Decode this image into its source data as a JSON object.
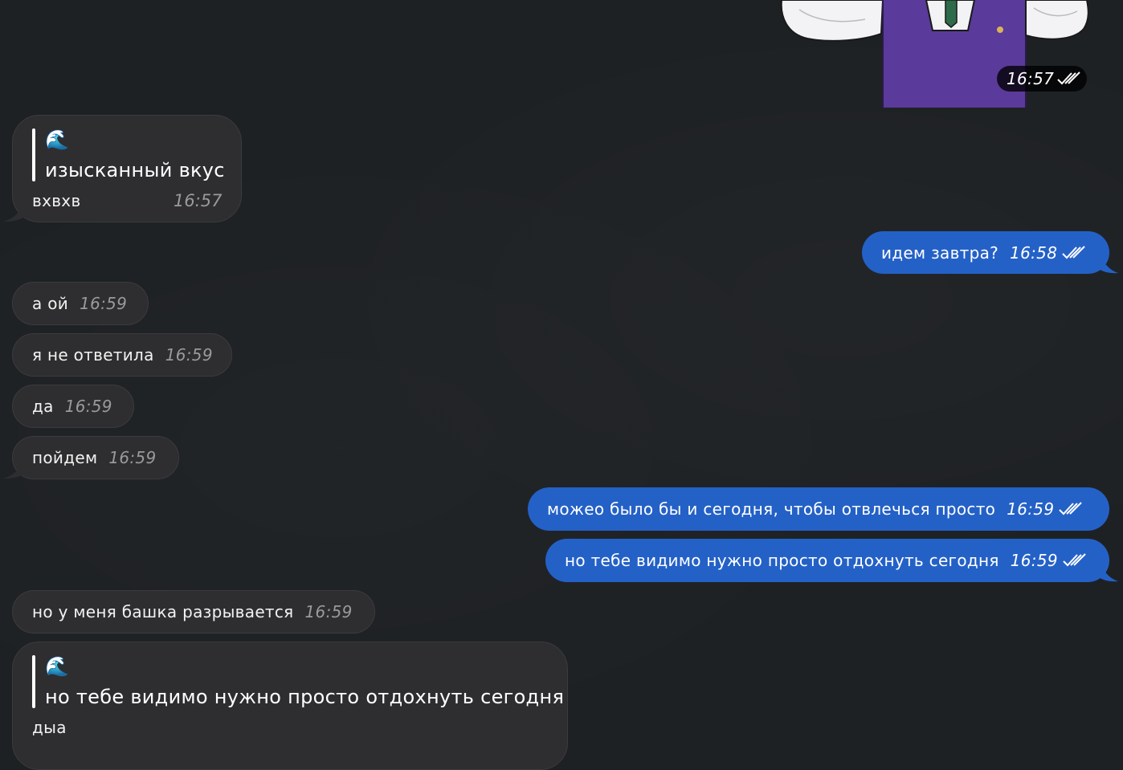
{
  "sticker": {
    "time": "16:57"
  },
  "messages": {
    "m1": {
      "author_icon": "🌊",
      "quote": "изысканный вкус",
      "text": "вхвхв",
      "time": "16:57"
    },
    "m2": {
      "text": "идем завтра?",
      "time": "16:58"
    },
    "m3": {
      "text": "а ой",
      "time": "16:59"
    },
    "m4": {
      "text": "я не ответила",
      "time": "16:59"
    },
    "m5": {
      "text": "да",
      "time": "16:59"
    },
    "m6": {
      "text": "пойдем",
      "time": "16:59"
    },
    "m7": {
      "text": "можео было бы и сегодня, чтобы отвлечься просто",
      "time": "16:59"
    },
    "m8": {
      "text": "но тебе видимо нужно просто отдохнуть сегодня",
      "time": "16:59"
    },
    "m9": {
      "text": "но у меня башка разрывается",
      "time": "16:59"
    },
    "m10": {
      "author_icon": "🌊",
      "quote": "но тебе видимо нужно просто отдохнуть сегодня",
      "text": "дыа"
    }
  },
  "colors": {
    "background": "#1e2124",
    "incoming": "#2e2e30",
    "outgoing": "#2461c7"
  },
  "icons": {
    "read_status": "double-check-icon",
    "reply_author": "wave-icon"
  }
}
